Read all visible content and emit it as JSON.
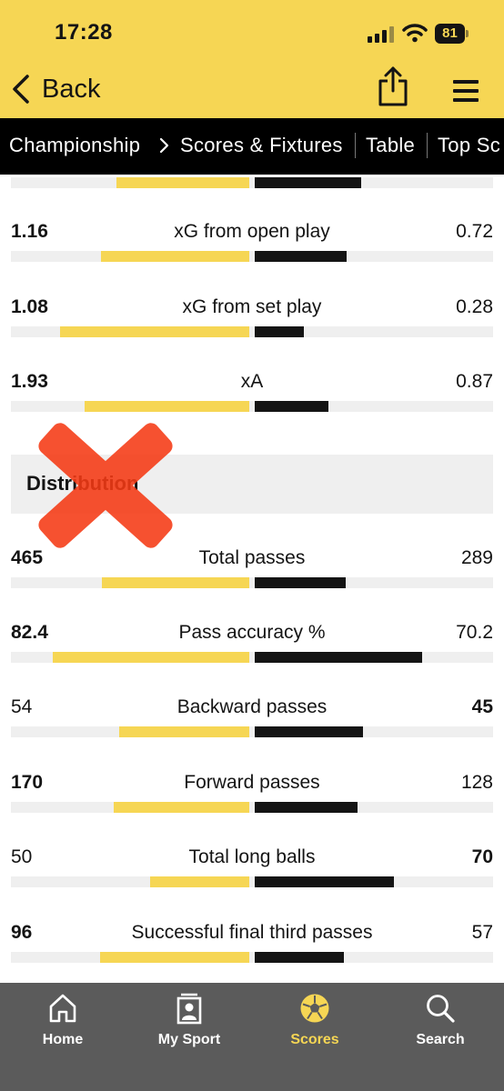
{
  "status_bar": {
    "time": "17:28",
    "battery": "81"
  },
  "header": {
    "back_label": "Back"
  },
  "nav": {
    "items": [
      "Championship",
      "Scores & Fixtures",
      "Table",
      "Top Sc"
    ]
  },
  "stats_top": [
    {
      "home": "1.16",
      "label": "xG from open play",
      "away": "0.72",
      "home_fraction": 0.624,
      "away_fraction": 0.387,
      "bold": "home"
    },
    {
      "home": "1.08",
      "label": "xG from set play",
      "away": "0.28",
      "home_fraction": 0.794,
      "away_fraction": 0.206,
      "bold": "home"
    },
    {
      "home": "1.93",
      "label": "xA",
      "away": "0.87",
      "home_fraction": 0.689,
      "away_fraction": 0.311,
      "bold": "home"
    }
  ],
  "section": {
    "title": "Distribution"
  },
  "stats_distribution": [
    {
      "home": "465",
      "label": "Total passes",
      "away": "289",
      "home_fraction": 0.617,
      "away_fraction": 0.383,
      "bold": "home"
    },
    {
      "home": "82.4",
      "label": "Pass accuracy %",
      "away": "70.2",
      "home_fraction": 0.824,
      "away_fraction": 0.702,
      "bold": "home"
    },
    {
      "home": "54",
      "label": "Backward passes",
      "away": "45",
      "home_fraction": 0.545,
      "away_fraction": 0.455,
      "bold": "away"
    },
    {
      "home": "170",
      "label": "Forward passes",
      "away": "128",
      "home_fraction": 0.57,
      "away_fraction": 0.43,
      "bold": "home"
    },
    {
      "home": "50",
      "label": "Total long balls",
      "away": "70",
      "home_fraction": 0.417,
      "away_fraction": 0.583,
      "bold": "away"
    },
    {
      "home": "96",
      "label": "Successful final third passes",
      "away": "57",
      "home_fraction": 0.627,
      "away_fraction": 0.373,
      "bold": "home"
    }
  ],
  "tabbar": {
    "items": [
      {
        "label": "Home",
        "icon": "home-icon"
      },
      {
        "label": "My Sport",
        "icon": "my-sport-icon"
      },
      {
        "label": "Scores",
        "icon": "football-icon",
        "active": true
      },
      {
        "label": "Search",
        "icon": "search-icon"
      }
    ]
  },
  "colors": {
    "header_yellow": "#f6d654",
    "home_bar": "#f6d654",
    "away_bar": "#141414",
    "nav_bg": "#000000",
    "tabbar_bg": "#5b5b5b",
    "overlay_cross": "#f53a14"
  }
}
